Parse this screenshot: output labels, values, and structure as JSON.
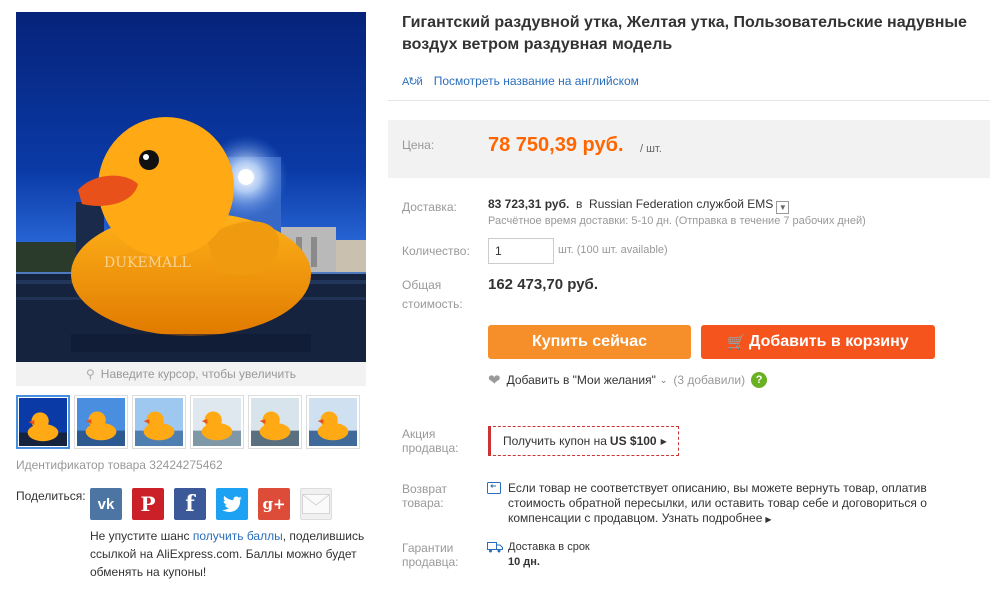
{
  "product": {
    "title": "Гигантский раздувной утка, Желтая утка, Пользовательские надувные воздух ветром раздувная модель",
    "translate_link": "Посмотреть название на английском",
    "watermark": "DUKEMALL",
    "zoom_hint": "Наведите курсор, чтобы увеличить",
    "product_id": "Идентификатор товара 32424275462"
  },
  "share": {
    "label": "Поделиться:",
    "icons": [
      "vk-icon",
      "pinterest-icon",
      "facebook-icon",
      "twitter-icon",
      "google-plus-icon",
      "mail-icon"
    ],
    "promo_before": "Не упустите шанс ",
    "promo_link": "получить баллы",
    "promo_after": ", поделившись ссылкой на AliExpress.com. Баллы можно будет обменять на купоны!"
  },
  "price": {
    "label": "Цена:",
    "value": "78 750,39 руб.",
    "unit": "/ шт."
  },
  "shipping": {
    "label": "Доставка:",
    "price": "83 723,31 руб.",
    "in_word": "в",
    "destination": "Russian Federation службой EMS",
    "estimate": "Расчётное время доставки: 5-10 дн. (Отправка в течение 7 рабочих дней)"
  },
  "quantity": {
    "label": "Количество:",
    "value": "1",
    "note": "шт. (100 шт. available)"
  },
  "total": {
    "label_line1": "Общая",
    "label_line2": "стоимость:",
    "value": "162 473,70 руб."
  },
  "buttons": {
    "buy_now": "Купить сейчас",
    "add_to_cart": "Добавить в корзину"
  },
  "wishlist": {
    "label": "Добавить в \"Мои желания\"",
    "count": "(3 добавили)"
  },
  "promo": {
    "label_line1": "Акция",
    "label_line2": "продавца:",
    "coupon_text": "Получить купон на",
    "coupon_amount": "US $100"
  },
  "returns": {
    "label_line1": "Возврат",
    "label_line2": "товара:",
    "text": "Если товар не соответствует описанию, вы можете вернуть товар, оплатив стоимость обратной пересылки, или оставить товар себе и договориться о компенсации с продавцом. Узнать подробнее"
  },
  "guarantee": {
    "label_line1": "Гарантии",
    "label_line2": "продавца:",
    "text": "Доставка в срок",
    "days": "10 дн."
  },
  "colors": {
    "price": "#ff6600",
    "buy_button": "#f68e2a",
    "cart_button": "#f5541c",
    "link": "#2a6ebb",
    "coupon_border": "#cc3333"
  }
}
